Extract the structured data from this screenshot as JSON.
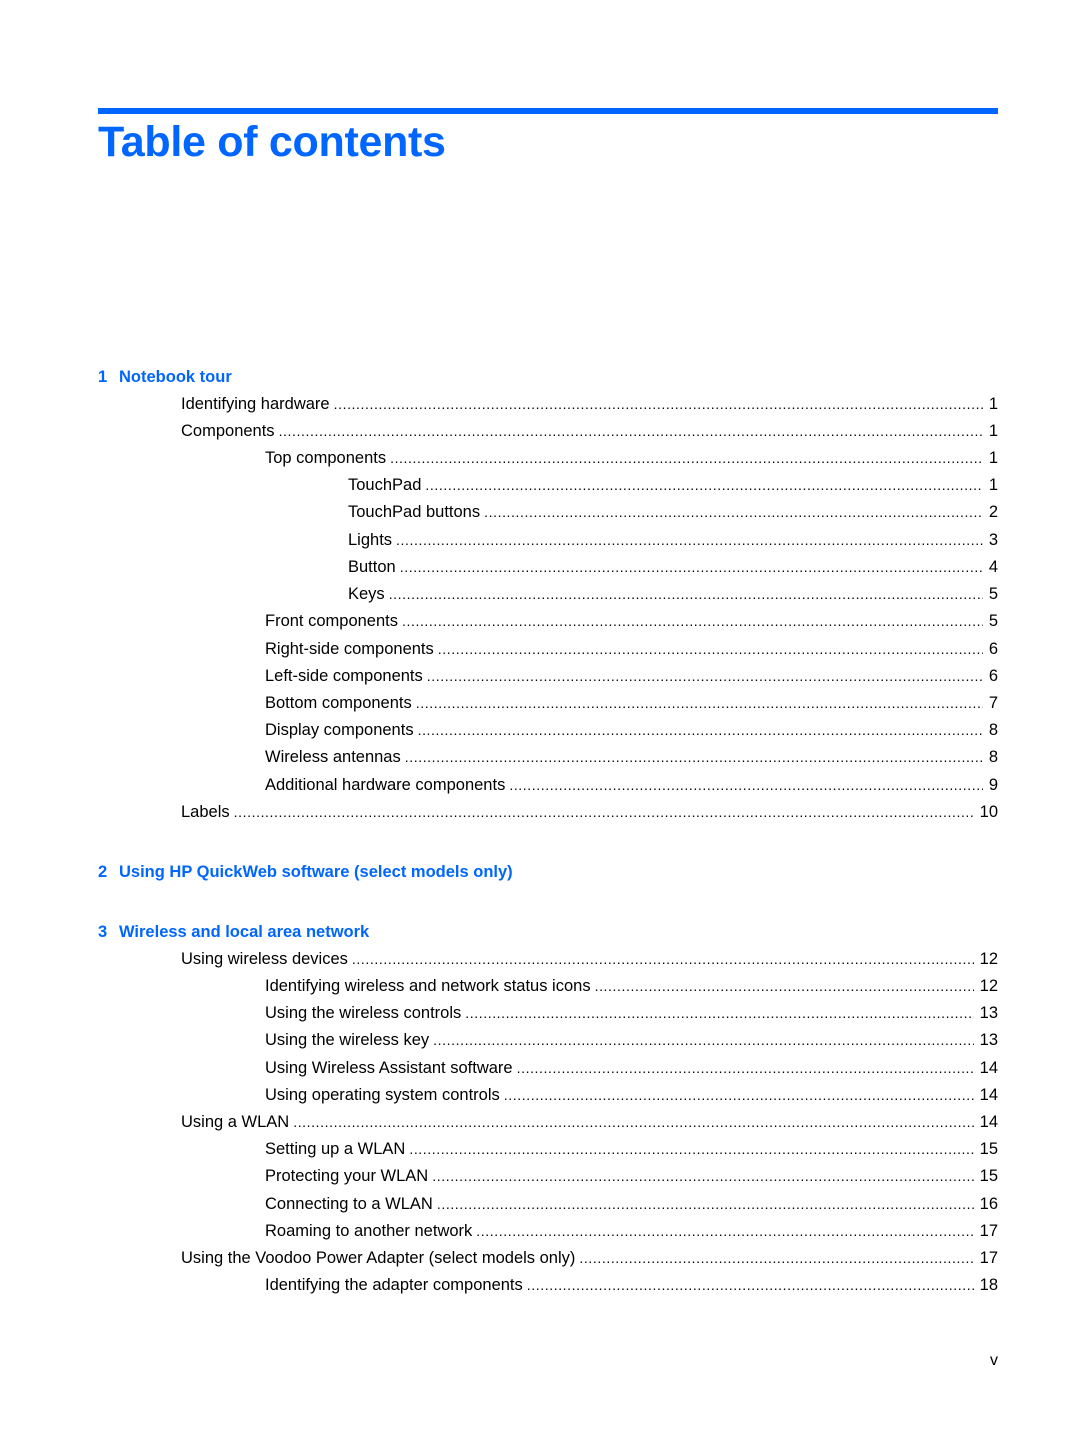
{
  "header": {
    "title": "Table of contents",
    "accent_color": "#0066ff"
  },
  "chapters": [
    {
      "number": "1",
      "title": "Notebook tour"
    },
    {
      "number": "2",
      "title": "Using HP QuickWeb software (select models only)"
    },
    {
      "number": "3",
      "title": "Wireless and local area network"
    }
  ],
  "entries": [
    {
      "label": "Identifying hardware",
      "page": "1"
    },
    {
      "label": "Components",
      "page": "1"
    },
    {
      "label": "Top components",
      "page": "1"
    },
    {
      "label": "TouchPad",
      "page": "1"
    },
    {
      "label": "TouchPad buttons",
      "page": "2"
    },
    {
      "label": "Lights",
      "page": "3"
    },
    {
      "label": "Button",
      "page": "4"
    },
    {
      "label": "Keys",
      "page": "5"
    },
    {
      "label": "Front components",
      "page": "5"
    },
    {
      "label": "Right-side components",
      "page": "6"
    },
    {
      "label": "Left-side components",
      "page": "6"
    },
    {
      "label": "Bottom components",
      "page": "7"
    },
    {
      "label": "Display components",
      "page": "8"
    },
    {
      "label": "Wireless antennas",
      "page": "8"
    },
    {
      "label": "Additional hardware components",
      "page": "9"
    },
    {
      "label": "Labels",
      "page": "10"
    },
    {
      "label": "Using wireless devices",
      "page": "12"
    },
    {
      "label": "Identifying wireless and network status icons",
      "page": "12"
    },
    {
      "label": "Using the wireless controls",
      "page": "13"
    },
    {
      "label": "Using the wireless key",
      "page": "13"
    },
    {
      "label": "Using Wireless Assistant software",
      "page": "14"
    },
    {
      "label": "Using operating system controls",
      "page": "14"
    },
    {
      "label": "Using a WLAN",
      "page": "14"
    },
    {
      "label": "Setting up a WLAN",
      "page": "15"
    },
    {
      "label": "Protecting your WLAN",
      "page": "15"
    },
    {
      "label": "Connecting to a WLAN",
      "page": "16"
    },
    {
      "label": "Roaming to another network",
      "page": "17"
    },
    {
      "label": "Using the Voodoo Power Adapter (select models only)",
      "page": "17"
    },
    {
      "label": "Identifying the adapter components",
      "page": "18"
    }
  ],
  "footer": {
    "page_number": "v"
  }
}
